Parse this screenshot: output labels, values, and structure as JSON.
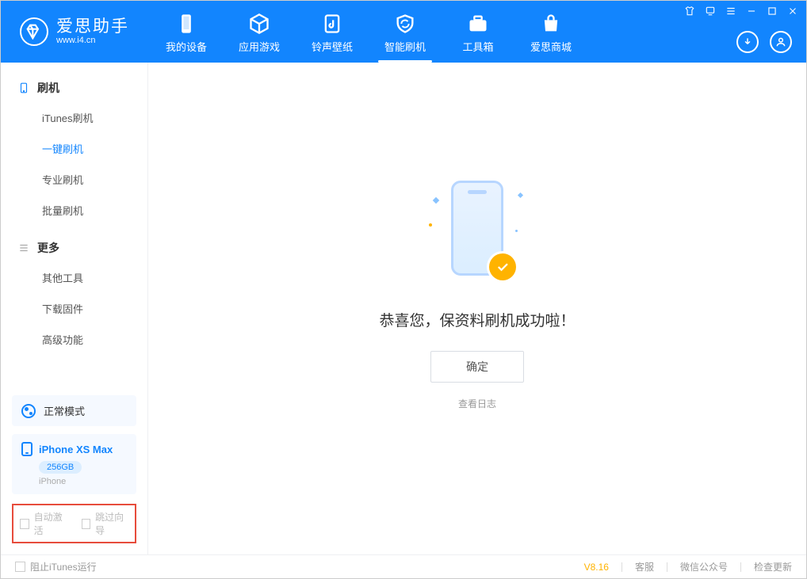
{
  "app": {
    "name": "爱思助手",
    "domain": "www.i4.cn"
  },
  "nav": {
    "items": [
      {
        "label": "我的设备"
      },
      {
        "label": "应用游戏"
      },
      {
        "label": "铃声壁纸"
      },
      {
        "label": "智能刷机"
      },
      {
        "label": "工具箱"
      },
      {
        "label": "爱思商城"
      }
    ],
    "active_index": 3
  },
  "sidebar": {
    "section_flash": "刷机",
    "section_more": "更多",
    "items": {
      "itunes": "iTunes刷机",
      "oneclick": "一键刷机",
      "pro": "专业刷机",
      "batch": "批量刷机",
      "othertools": "其他工具",
      "firmware": "下载固件",
      "advanced": "高级功能"
    },
    "active": "oneclick"
  },
  "mode": {
    "label": "正常模式"
  },
  "device": {
    "name": "iPhone XS Max",
    "storage": "256GB",
    "type": "iPhone"
  },
  "options": {
    "auto_activate": "自动激活",
    "skip_guide": "跳过向导"
  },
  "main": {
    "success_text": "恭喜您，保资料刷机成功啦！",
    "ok_label": "确定",
    "log_link": "查看日志"
  },
  "footer": {
    "block_itunes": "阻止iTunes运行",
    "version": "V8.16",
    "links": {
      "service": "客服",
      "wechat": "微信公众号",
      "update": "检查更新"
    }
  }
}
